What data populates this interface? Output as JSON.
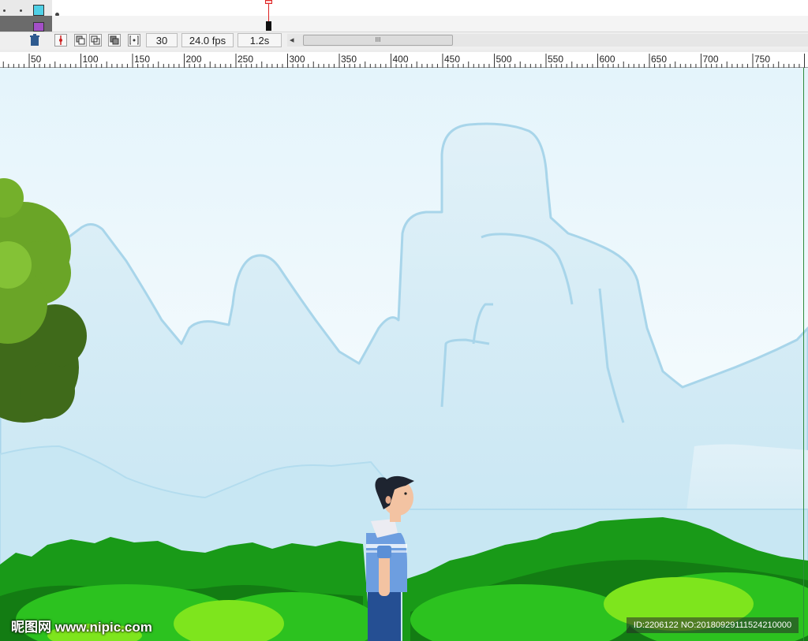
{
  "timeline": {
    "current_frame": "30",
    "fps": "24.0 fps",
    "elapsed": "1.2s",
    "scroll_grip": "III",
    "scroll_left_arrow": "◂",
    "layer_swatch_colors": [
      "#4fd0e6",
      "#a34fc7"
    ]
  },
  "ruler": {
    "labels": [
      "50",
      "100",
      "150",
      "200",
      "250",
      "300",
      "350",
      "400",
      "450",
      "500",
      "550",
      "600",
      "650",
      "700",
      "750"
    ]
  },
  "scene": {
    "sky_top": "#eaf6fb",
    "mountain_fill": "#c6e6f3",
    "mountain_stroke": "#a9d6ea",
    "bush_dark": "#1a9c1a",
    "bush_light": "#7de31d",
    "tree_light": "#6aa527",
    "tree_dark": "#3e6b1a"
  },
  "watermark": {
    "logo": "昵图网 www.nipic.com",
    "id_text": "ID:2206122 NO:20180929111524210000"
  }
}
